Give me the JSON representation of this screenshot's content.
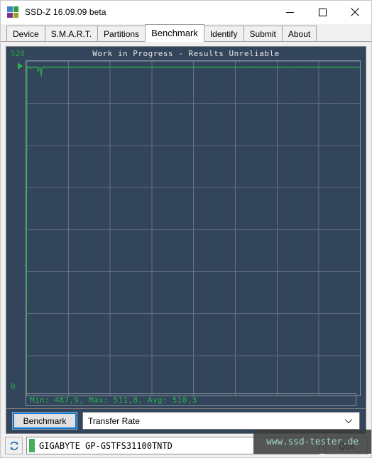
{
  "window": {
    "title": "SSD-Z 16.09.09 beta",
    "icon": "app-tiles-icon",
    "icon_colors": [
      "#3d86c6",
      "#2f9e45",
      "#7b2f8f",
      "#9aa326"
    ],
    "controls": {
      "minimize": "minimize-icon",
      "maximize": "maximize-icon",
      "close": "close-icon"
    }
  },
  "tabs": [
    {
      "label": "Device",
      "active": false
    },
    {
      "label": "S.M.A.R.T.",
      "active": false
    },
    {
      "label": "Partitions",
      "active": false
    },
    {
      "label": "Benchmark",
      "active": true
    },
    {
      "label": "Identify",
      "active": false
    },
    {
      "label": "Submit",
      "active": false
    },
    {
      "label": "About",
      "active": false
    }
  ],
  "benchmark": {
    "warning_title": "Work in Progress - Results Unreliable",
    "y_max_label": "520",
    "y_min_label": "0",
    "stats_text": "Min: 487,9, Max: 511,8, Avg: 510,3",
    "run_button": "Benchmark",
    "mode_select_value": "Transfer Rate",
    "mode_select_options": [
      "Transfer Rate"
    ],
    "cursor_marker": "playhead-marker"
  },
  "chart_data": {
    "type": "line",
    "title": "Work in Progress - Results Unreliable",
    "xlabel": "",
    "ylabel": "",
    "ylim": [
      0,
      520
    ],
    "ytick_labels": [
      "520",
      "0"
    ],
    "grid": true,
    "legend": false,
    "line_color": "#2ab14d",
    "background_color": "#33455a",
    "stats": {
      "min": 487.9,
      "max": 511.8,
      "avg": 510.3
    },
    "series": [
      {
        "name": "Transfer Rate",
        "values": [
          0,
          511.8,
          510.6,
          509.4,
          511.1,
          510.0,
          508.2,
          510.7,
          509.8,
          511.0,
          510.2,
          509.1,
          510.9,
          510.3,
          509.6,
          511.2,
          510.4,
          503.5,
          509.0,
          510.8,
          510.1,
          496.2,
          509.3,
          510.5,
          509.9,
          511.3,
          510.0,
          509.2,
          510.6,
          510.9,
          509.5,
          511.0,
          510.3,
          509.7,
          510.8,
          510.2,
          511.4,
          509.8,
          510.5,
          510.1,
          509.4,
          510.7,
          511.1,
          510.0,
          509.6,
          510.9,
          510.4,
          511.2,
          509.9,
          510.6,
          510.3,
          509.1,
          510.8,
          511.0,
          510.2,
          509.7,
          510.5,
          510.9,
          511.3,
          510.1,
          509.5,
          510.7,
          510.4,
          511.1,
          509.8,
          510.6,
          510.0,
          509.3,
          510.9,
          511.2,
          510.3,
          509.9,
          510.5,
          510.8,
          511.0,
          510.2,
          509.6,
          510.7,
          511.4,
          510.1,
          510.6,
          509.4,
          511.1,
          510.5,
          510.0,
          509.8,
          510.9,
          511.2,
          510.3,
          509.5,
          510.7,
          511.0,
          510.4,
          509.9,
          510.6,
          510.2,
          511.1,
          510.8,
          509.7,
          510.5,
          510.9,
          511.3,
          510.1,
          509.6,
          510.7,
          510.4,
          511.0,
          510.2,
          509.8,
          510.6,
          511.2,
          510.3,
          509.4,
          510.9,
          510.5,
          511.1,
          510.0,
          509.9,
          510.8,
          510.4,
          511.0,
          510.2,
          509.7,
          510.6,
          511.3,
          510.1,
          510.5,
          509.5,
          510.9,
          511.0,
          510.3,
          509.8,
          510.7,
          510.4,
          511.2,
          510.0,
          509.6,
          510.8,
          510.5,
          511.1,
          510.2,
          509.9,
          510.6,
          510.3,
          511.0,
          510.7,
          509.4,
          510.9,
          511.2,
          510.1,
          510.5,
          509.7,
          510.8,
          511.0,
          510.4,
          509.9,
          510.6,
          510.2,
          511.1,
          510.3,
          509.5,
          510.9,
          510.7,
          511.3,
          510.0,
          509.8,
          510.5,
          510.4,
          511.0,
          510.1,
          509.6,
          510.8,
          510.6,
          511.2,
          510.3,
          509.9,
          510.7,
          510.2,
          511.1,
          510.5,
          509.4,
          510.9,
          510.0,
          511.0,
          510.4,
          509.7,
          510.6,
          510.3,
          511.2,
          510.8,
          509.5,
          510.1,
          510.7,
          511.1,
          510.2,
          509.8,
          510.5,
          510.9,
          510.0,
          511.0,
          510.6,
          509.6,
          510.3,
          510.8,
          511.2,
          510.4,
          509.9,
          510.7,
          510.1,
          511.1,
          510.5,
          509.3,
          510.2,
          510.9,
          510.6,
          511.0,
          510.0,
          509.7,
          510.8,
          510.4,
          511.3,
          510.1,
          509.5,
          510.6,
          510.9,
          510.3,
          511.1,
          510.7,
          509.8,
          510.2,
          510.5,
          511.0,
          510.4,
          509.6,
          510.8,
          510.1,
          511.2,
          510.9,
          510.3,
          509.4,
          510.7,
          510.6,
          511.0,
          510.2,
          509.9,
          510.5,
          510.8,
          511.1,
          510.0,
          509.7,
          510.4,
          510.9,
          510.3,
          511.2,
          510.6,
          509.5,
          510.1,
          510.7,
          511.0,
          510.5,
          509.8,
          510.2,
          510.9,
          510.4,
          511.1,
          510.6,
          509.6,
          510.3,
          510.8,
          510.0,
          511.0,
          510.5,
          509.9,
          510.7,
          510.2,
          511.2,
          510.4,
          509.4,
          510.6,
          510.9,
          510.1,
          511.1,
          510.8,
          509.7,
          510.3,
          510.5,
          511.0,
          510.2,
          509.8,
          510.7,
          510.4,
          510.9,
          511.1,
          510.0,
          509.5,
          510.6,
          510.3,
          510.8,
          511.2,
          510.1,
          509.9,
          510.5,
          510.7,
          510.2,
          511.0,
          510.4,
          509.6,
          510.9,
          510.3,
          510.6,
          511.1,
          510.0,
          509.8,
          510.7,
          510.5,
          511.0,
          510.2,
          509.4,
          510.8,
          510.1,
          510.6,
          511.2,
          510.3,
          509.7,
          510.9,
          510.4,
          511.0,
          510.5,
          509.9,
          510.2,
          510.7,
          510.0,
          511.1,
          510.6,
          509.5,
          510.3,
          510.8,
          510.4,
          511.0,
          510.1,
          509.8,
          510.9,
          510.5,
          510.2,
          511.2,
          510.6,
          509.6,
          510.0,
          510.7,
          510.3,
          511.1,
          510.4,
          509.9,
          510.8,
          510.2,
          510.5,
          511.0,
          510.1,
          509.7,
          510.6,
          510.9,
          510.3,
          511.2,
          510.0,
          509.5,
          510.4,
          510.8,
          510.7,
          511.1,
          510.2,
          509.8,
          510.5,
          510.3,
          510.9,
          511.0,
          510.6,
          509.9,
          510.1,
          510.7,
          510.4,
          511.2,
          510.0,
          509.6,
          510.8,
          510.5,
          510.2,
          511.1,
          510.3,
          509.4,
          510.9,
          510.6,
          510.0,
          511.0,
          510.4,
          509.7,
          510.8,
          510.1,
          510.5,
          511.2,
          510.3,
          509.9,
          510.7,
          510.2,
          510.6,
          511.1,
          510.0,
          509.8,
          510.4,
          510.9,
          510.5,
          511.0,
          510.2,
          509.5,
          510.7,
          510.3,
          510.8,
          511.1,
          510.6,
          509.9,
          510.1,
          510.4,
          510.9,
          511.0,
          510.5,
          509.7,
          510.2,
          510.8,
          510.3,
          511.2,
          510.0,
          509.6,
          510.6,
          510.7,
          510.4,
          511.0,
          510.1,
          509.8,
          510.9,
          510.5,
          510.2,
          511.1,
          510.3,
          509.4,
          510.7,
          510.6,
          510.0,
          511.0,
          510.8,
          509.9,
          510.4,
          510.2,
          510.5,
          511.2,
          510.1,
          509.7,
          510.9,
          510.6,
          510.3,
          511.0,
          510.0,
          509.5,
          510.8,
          510.4,
          510.7,
          511.1,
          510.2,
          509.9,
          510.5,
          510.3,
          510.6
        ]
      }
    ]
  },
  "statusbar": {
    "refresh_icon": "refresh-icon",
    "health_indicator": "health-bar",
    "drive_name": "GIGABYTE GP-GSTFS31100TNTD",
    "quit_button": "Quit"
  },
  "watermark": {
    "text": "www.ssd-tester.de"
  }
}
